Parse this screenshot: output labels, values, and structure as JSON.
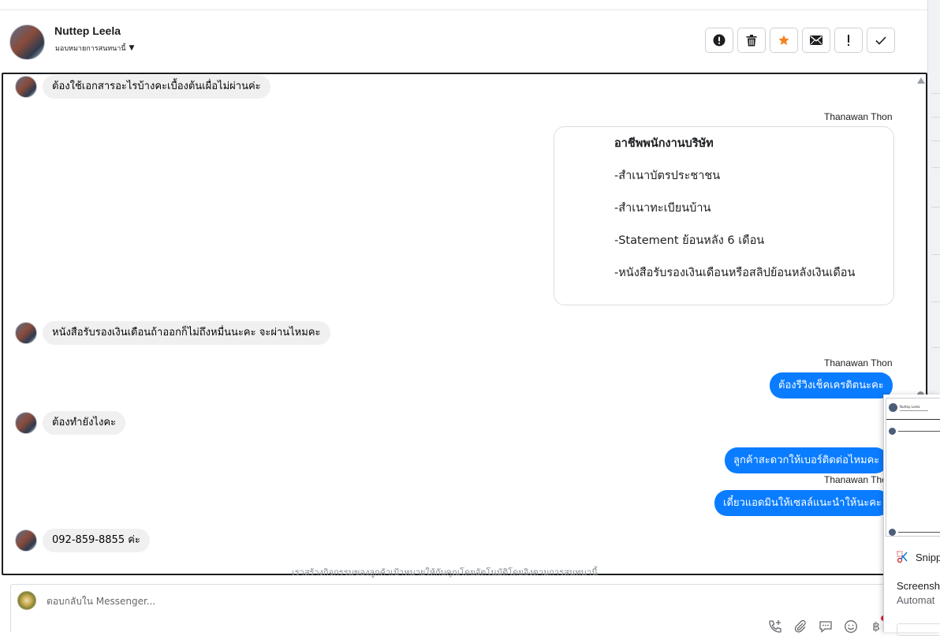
{
  "header": {
    "name": "Nuttep Leela",
    "assign_label": "มอบหมายการสนทนานี้",
    "actions": [
      {
        "name": "spam-report-button",
        "icon": "exclamation-circle-icon"
      },
      {
        "name": "delete-button",
        "icon": "trash-icon"
      },
      {
        "name": "star-button",
        "icon": "star-icon"
      },
      {
        "name": "mark-unread-button",
        "icon": "envelope-icon"
      },
      {
        "name": "follow-up-button",
        "icon": "exclamation-icon"
      },
      {
        "name": "mark-done-button",
        "icon": "checkmark-icon"
      }
    ],
    "star_color": "#f5821f"
  },
  "messages": {
    "m1": "ต้องใช้เอกสารอะไรบ้างคะเบื้องต้นเผื่อไม่ผ่านค่ะ",
    "sender_a": "Thanawan Thon",
    "card": {
      "title": "อาชีพพนักงานบริษัท",
      "items": [
        "-สำเนาบัตรประชาชน",
        "-สำเนาทะเบียนบ้าน",
        "-Statement ย้อนหลัง 6 เดือน",
        "-หนังสือรับรองเงินเดือนหรือสลิปย้อนหลังเงินเดือน"
      ]
    },
    "m2": "หนังสือรับรองเงินเดือนถ้าออกก็ไม่ถึงหมื่นนะคะ จะผ่านไหมคะ",
    "sender_b": "Thanawan Thon",
    "m3": "ต้องรีวิงเช็คเครดิตนะคะ",
    "m4": "ต้องทำยังไงคะ",
    "m5": "ลูกค้าสะดวกให้เบอร์ติดต่อไหมคะ",
    "sender_c": "Thanawan Thon",
    "m6": "เดี๋ยวแอดมินให้เซลล์แนะนำให้นะคะ",
    "m7": "092-859-8855 ค่ะ",
    "bubble_color": "#0a7cff"
  },
  "footer_note": "เราสร้างกิจกรรมของลูกค้าเป้าหมายให้กับคุณโดยอัตโนมัติโดยอิงตามการสนทนานี้",
  "reply": {
    "placeholder": "ตอบกลับใน Messenger..."
  },
  "snip_panel": {
    "thumb_name": "Nuttep Leela",
    "app_label": "Snipp",
    "notif_title": "Screensh",
    "notif_sub": "Automat"
  }
}
